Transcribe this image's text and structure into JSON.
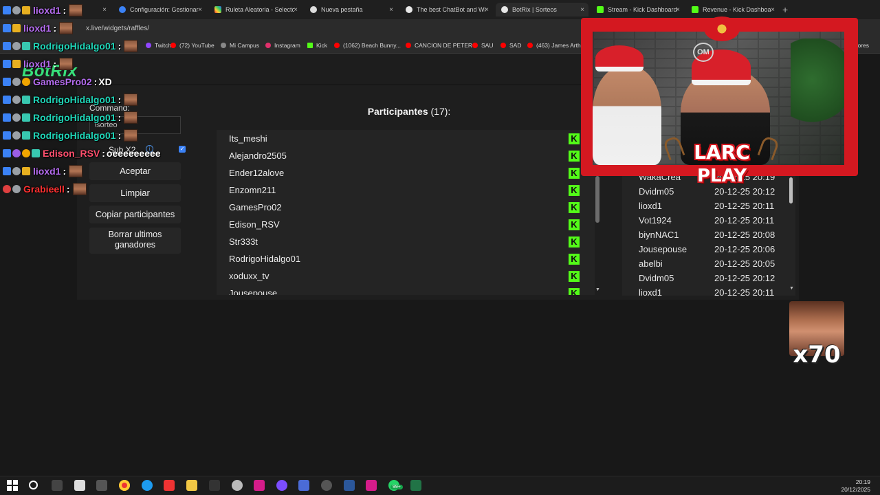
{
  "browser": {
    "tabs": [
      {
        "title": "",
        "active": false
      },
      {
        "title": "Configuración: Gestionar",
        "active": false
      },
      {
        "title": "Ruleta Aleatoria - Selecto",
        "active": false
      },
      {
        "title": "Nueva pestaña",
        "active": false
      },
      {
        "title": "The best ChatBot and Wi",
        "active": false
      },
      {
        "title": "BotRix | Sorteos",
        "active": true
      },
      {
        "title": "Stream - Kick Dashboard",
        "active": false
      },
      {
        "title": "Revenue - Kick Dashboar",
        "active": false
      }
    ],
    "tab_close": "×",
    "new_tab": "+",
    "url": "x.live/widgets/raffles/",
    "bookmarks": [
      {
        "label": "Twitch"
      },
      {
        "label": "(72) YouTube"
      },
      {
        "label": "Mi Campus"
      },
      {
        "label": "Instagram"
      },
      {
        "label": "Kick"
      },
      {
        "label": "(1062) Beach Bunny..."
      },
      {
        "label": "CANCION DE PETER"
      },
      {
        "label": "SAU"
      },
      {
        "label": "SAD"
      },
      {
        "label": "(463) James Arthu"
      }
    ],
    "bookmarks_overflow": "adores"
  },
  "botrix": {
    "logo": "BotRix",
    "command_label": "Command:",
    "command_value": "!sorteo",
    "sub_label": "Sub X2",
    "sub_info_glyph": "i",
    "sub_checked": true,
    "check_glyph": "✓",
    "buttons": {
      "accept": "Aceptar",
      "clear": "Limpiar",
      "copy": "Copiar participantes",
      "delete_winners": "Borrar ultimos ganadores"
    },
    "participants_title": "Participantes",
    "participants_count": "(17):",
    "kick_glyph": "K",
    "scroll_down_glyph": "▼",
    "participants": [
      "Its_meshi",
      "Alejandro2505",
      "Ender12alove",
      "Enzomn211",
      "GamesPro02",
      "Edison_RSV",
      "Str333t",
      "RodrigoHidalgo01",
      "xoduxx_tv",
      "Jousepouse"
    ],
    "winners": [
      {
        "name": "WakaCrea",
        "date": "20-12-25 20:19"
      },
      {
        "name": "Dvidm05",
        "date": "20-12-25 20:12"
      },
      {
        "name": "lioxd1",
        "date": "20-12-25 20:11"
      },
      {
        "name": "Vot1924",
        "date": "20-12-25 20:11"
      },
      {
        "name": "biynNAC1",
        "date": "20-12-25 20:08"
      },
      {
        "name": "Jousepouse",
        "date": "20-12-25 20:06"
      },
      {
        "name": "abelbi",
        "date": "20-12-25 20:05"
      },
      {
        "name": "Dvidm05",
        "date": "20-12-25 20:12"
      },
      {
        "name": "lioxd1",
        "date": "20-12-25 20:11"
      }
    ]
  },
  "chat": [
    {
      "user": "lioxd1",
      "color": "#b56cf0",
      "message": "",
      "emote": true
    },
    {
      "user": "lioxd1",
      "color": "#b56cf0",
      "message": "",
      "emote": true
    },
    {
      "user": "RodrigoHidalgo01",
      "color": "#1fd6b8",
      "message": "",
      "emote": true
    },
    {
      "user": "lioxd1",
      "color": "#b56cf0",
      "message": "",
      "emote": true
    },
    {
      "user": "GamesPro02",
      "color": "#b56cf0",
      "message": "XD",
      "emote": false
    },
    {
      "user": "RodrigoHidalgo01",
      "color": "#1fd6b8",
      "message": "",
      "emote": true
    },
    {
      "user": "RodrigoHidalgo01",
      "color": "#1fd6b8",
      "message": "",
      "emote": true
    },
    {
      "user": "RodrigoHidalgo01",
      "color": "#1fd6b8",
      "message": "",
      "emote": true
    },
    {
      "user": "Edison_RSV",
      "color": "#ff4f6d",
      "message": "oeeeeeeeee",
      "emote": false
    },
    {
      "user": "lioxd1",
      "color": "#b56cf0",
      "message": "",
      "emote": true
    },
    {
      "user": "Grabieell",
      "color": "#ff3030",
      "message": "",
      "emote": true
    }
  ],
  "chat_separator": ":",
  "stream_overlay": {
    "cam_logo": "OM",
    "brand_top": "LARC",
    "brand_bottom": "PLAY",
    "emote_combo": "x70"
  },
  "taskbar": {
    "time": "20:19",
    "date": "20/12/2025",
    "whatsapp_badge": "99+"
  }
}
